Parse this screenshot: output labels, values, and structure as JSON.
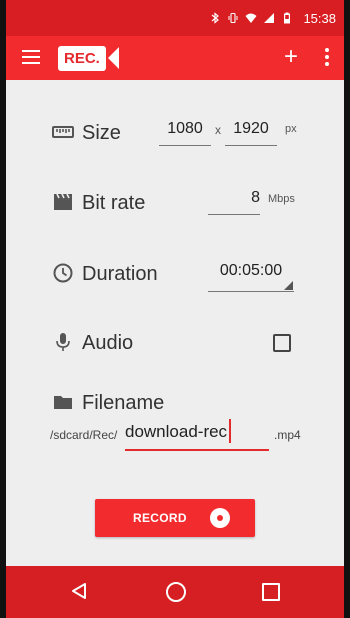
{
  "status_bar": {
    "time": "15:38"
  },
  "app_bar": {
    "logo_text": "REC.",
    "add_icon": "+"
  },
  "size": {
    "label": "Size",
    "width": "1080",
    "separator": "x",
    "height": "1920",
    "unit": "px"
  },
  "bitrate": {
    "label": "Bit rate",
    "value": "8",
    "unit": "Mbps"
  },
  "duration": {
    "label": "Duration",
    "value": "00:05:00"
  },
  "audio": {
    "label": "Audio",
    "checked": false
  },
  "filename": {
    "label": "Filename",
    "path": "/sdcard/Rec/",
    "value": "download-rec",
    "extension": ".mp4"
  },
  "record_button": {
    "label": "RECORD"
  },
  "colors": {
    "primary": "#f22b2f",
    "status": "#d81e22",
    "background": "#eeeeee",
    "cursor": "#e52a2d"
  }
}
